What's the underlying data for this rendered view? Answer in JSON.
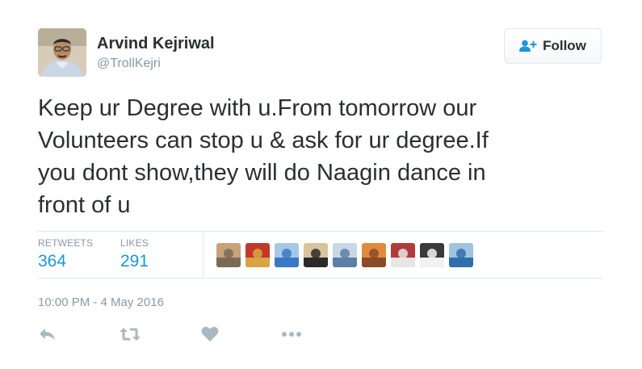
{
  "author": {
    "name": "Arvind Kejriwal",
    "handle": "@TrollKejri",
    "avatar_icon": "person-photo"
  },
  "follow": {
    "label": "Follow",
    "icon": "add-user-icon",
    "color": "#1b95e0"
  },
  "tweet": {
    "text": "Keep ur Degree with u.From tomorrow our\nVolunteers can stop u & ask for ur degree.If\nyou dont show,they will do Naagin dance in\nfront of u"
  },
  "stats": {
    "retweets_label": "RETWEETS",
    "retweets_count": "364",
    "likes_label": "LIKES",
    "likes_count": "291"
  },
  "likers": [
    {
      "icon": "liker-avatar-1",
      "colors": [
        "#7a6a55",
        "#c9a27a"
      ]
    },
    {
      "icon": "liker-avatar-2",
      "colors": [
        "#d9a441",
        "#c0392b"
      ]
    },
    {
      "icon": "liker-avatar-3",
      "colors": [
        "#3b78c2",
        "#a7c7e7"
      ]
    },
    {
      "icon": "liker-avatar-4",
      "colors": [
        "#2a2a2a",
        "#d8c39a"
      ]
    },
    {
      "icon": "liker-avatar-5",
      "colors": [
        "#5b7fa6",
        "#c8d6e5"
      ]
    },
    {
      "icon": "liker-avatar-6",
      "colors": [
        "#8a4b2a",
        "#e08a3c"
      ]
    },
    {
      "icon": "liker-avatar-7",
      "colors": [
        "#e6e6e6",
        "#b33a3a"
      ]
    },
    {
      "icon": "liker-avatar-8",
      "colors": [
        "#f2f2f2",
        "#3a3a3a"
      ]
    },
    {
      "icon": "liker-avatar-9",
      "colors": [
        "#2f6fa8",
        "#9fc3e0"
      ]
    }
  ],
  "timestamp": "10:00 PM - 4 May 2016",
  "actions": {
    "reply_icon": "reply-icon",
    "retweet_icon": "retweet-icon",
    "like_icon": "heart-icon",
    "more_icon": "more-icon"
  },
  "colors": {
    "accent": "#1b95e0",
    "muted": "#8899a6",
    "icon": "#aab8c2",
    "text": "#292f33"
  }
}
